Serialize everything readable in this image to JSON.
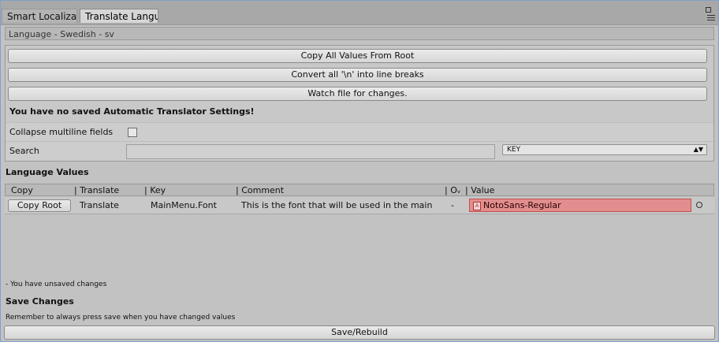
{
  "tabs": [
    {
      "label": "Smart Localizat",
      "active": false
    },
    {
      "label": "Translate Langu",
      "active": true
    }
  ],
  "header": {
    "title": "Language - Swedish - sv"
  },
  "buttons": {
    "copy_all": "Copy All Values From Root",
    "convert_breaks": "Convert all '\\n' into line breaks",
    "watch_file": "Watch file for changes."
  },
  "warning": "You have no saved Automatic Translator Settings!",
  "collapse": {
    "label": "Collapse multiline fields",
    "checked": false
  },
  "search": {
    "label": "Search",
    "value": "",
    "dropdown_value": "KEY"
  },
  "language_values": {
    "title": "Language Values",
    "columns": [
      "Copy",
      "| Translate",
      "| Key",
      "| Comment",
      "| Oᵥ",
      "| Value"
    ],
    "rows": [
      {
        "copy_button": "Copy Root",
        "translate": "Translate",
        "key": "MainMenu.Font",
        "comment": "This is the font that will be used in the main",
        "override": "-",
        "value": "NotoSans-Regular"
      }
    ]
  },
  "status": {
    "unsaved": "- You have unsaved changes"
  },
  "save": {
    "title": "Save Changes",
    "hint": "Remember to always press save when you have changed values",
    "button": "Save/Rebuild"
  },
  "colors": {
    "value_field_bg": "#e28e8e",
    "window_border": "#7da2ce"
  },
  "icons": [
    "window-pin-icon",
    "window-menu-icon",
    "font-asset-icon",
    "object-picker-icon",
    "dropdown-arrows-icon"
  ]
}
